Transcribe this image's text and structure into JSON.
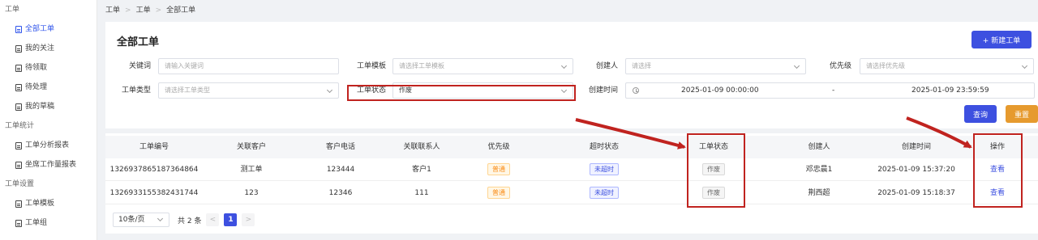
{
  "sidebar": {
    "groups": [
      {
        "label": "工单",
        "items": [
          {
            "label": "全部工单",
            "active": true
          },
          {
            "label": "我的关注"
          },
          {
            "label": "待领取"
          },
          {
            "label": "待处理"
          },
          {
            "label": "我的草稿"
          }
        ]
      },
      {
        "label": "工单统计",
        "items": [
          {
            "label": "工单分析报表"
          },
          {
            "label": "坐席工作量报表"
          }
        ]
      },
      {
        "label": "工单设置",
        "items": [
          {
            "label": "工单模板"
          },
          {
            "label": "工单组"
          }
        ]
      }
    ]
  },
  "breadcrumb": [
    "工单",
    "工单",
    "全部工单"
  ],
  "page": {
    "title": "全部工单",
    "new_button": "+ 新建工单"
  },
  "filters": {
    "keyword": {
      "label": "关键词",
      "placeholder": "请输入关键词"
    },
    "template": {
      "label": "工单模板",
      "placeholder": "请选择工单模板"
    },
    "creator": {
      "label": "创建人",
      "placeholder": "请选择"
    },
    "priority": {
      "label": "优先级",
      "placeholder": "请选择优先级"
    },
    "type": {
      "label": "工单类型",
      "placeholder": "请选择工单类型"
    },
    "status": {
      "label": "工单状态",
      "value": "作废"
    },
    "created_time": {
      "label": "创建时间",
      "start": "2025-01-09 00:00:00",
      "sep": "-",
      "end": "2025-01-09 23:59:59"
    },
    "query_button": "查询",
    "reset_button": "重置"
  },
  "table": {
    "columns": [
      "工单编号",
      "关联客户",
      "客户电话",
      "关联联系人",
      "优先级",
      "超时状态",
      "工单状态",
      "创建人",
      "创建时间",
      "操作"
    ],
    "rows": [
      {
        "id": "1326937865187364864",
        "customer": "测工单",
        "phone": "123444",
        "contact": "客户1",
        "priority": "普通",
        "overtime": "未超时",
        "status": "作废",
        "creator": "邓忠晨1",
        "created": "2025-01-09 15:37:20",
        "action": "查看"
      },
      {
        "id": "1326933155382431744",
        "customer": "123",
        "phone": "12346",
        "contact": "111",
        "priority": "普通",
        "overtime": "未超时",
        "status": "作废",
        "creator": "荆西超",
        "created": "2025-01-09 15:18:37",
        "action": "查看"
      }
    ]
  },
  "pagination": {
    "page_size": "10条/页",
    "total": "共 2 条",
    "prev": "<",
    "current": "1",
    "next": ">"
  },
  "colors": {
    "accent": "#3d50e0",
    "reset": "#e69a2e",
    "highlight": "#c0231f"
  }
}
